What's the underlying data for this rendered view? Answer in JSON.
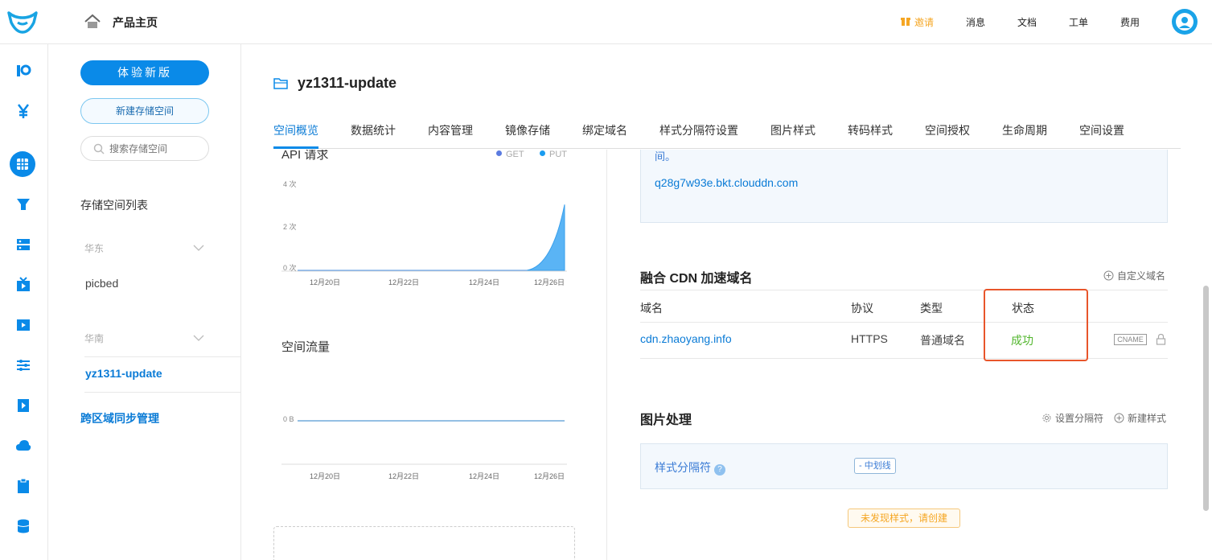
{
  "header": {
    "home_label": "产品主页",
    "nav": {
      "invite": "邀请",
      "messages": "消息",
      "docs": "文档",
      "tickets": "工单",
      "billing": "费用"
    }
  },
  "rail": {
    "icons": [
      "kodo-icon",
      "yuan-icon",
      "storage-grid-icon",
      "cdn-icon",
      "server-icon",
      "live-icon",
      "video-icon",
      "sliders-icon",
      "play-icon",
      "cloud-icon",
      "clipboard-icon",
      "database-icon"
    ]
  },
  "sidebar": {
    "try_new_version": "体验新版",
    "new_bucket": "新建存储空间",
    "search_placeholder": "搜索存储空间",
    "list_title": "存储空间列表",
    "regions": [
      {
        "name": "华东",
        "buckets": [
          "picbed"
        ]
      },
      {
        "name": "华南",
        "buckets": [
          "yz1311-update"
        ]
      }
    ],
    "active_bucket": "yz1311-update",
    "sync_link": "跨区域同步管理"
  },
  "main": {
    "bucket_name": "yz1311-update",
    "tabs": [
      "空间概览",
      "数据统计",
      "内容管理",
      "镜像存储",
      "绑定域名",
      "样式分隔符设置",
      "图片样式",
      "转码样式",
      "空间授权",
      "生命周期",
      "空间设置"
    ],
    "active_tab": "空间概览"
  },
  "charts": {
    "api": {
      "title": "API 请求",
      "legend": [
        "GET",
        "PUT"
      ],
      "yticks": [
        "4 次",
        "2 次",
        "0 次"
      ],
      "xticks": [
        "12月20日",
        "12月22日",
        "12月24日",
        "12月26日"
      ]
    },
    "traffic": {
      "title": "空间流量",
      "yticks": [
        "0 B"
      ],
      "xticks": [
        "12月20日",
        "12月22日",
        "12月24日",
        "12月26日"
      ]
    }
  },
  "chart_data": [
    {
      "type": "area",
      "title": "API 请求",
      "categories": [
        "12月20日",
        "12月22日",
        "12月24日",
        "12月26日"
      ],
      "series": [
        {
          "name": "GET",
          "values": [
            0,
            0,
            0,
            0
          ]
        },
        {
          "name": "PUT",
          "values": [
            0,
            0,
            0,
            3
          ]
        }
      ],
      "yticks": [
        "0 次",
        "2 次",
        "4 次"
      ],
      "ylim": [
        0,
        4
      ]
    },
    {
      "type": "line",
      "title": "空间流量",
      "categories": [
        "12月20日",
        "12月22日",
        "12月24日",
        "12月26日"
      ],
      "series": [
        {
          "values": [
            0,
            0,
            0,
            0
          ]
        }
      ],
      "yticks": [
        "0 B"
      ]
    }
  ],
  "test_domain": {
    "note_tail": "间。",
    "domain": "q28g7w93e.bkt.clouddn.com"
  },
  "cdn": {
    "title": "融合 CDN 加速域名",
    "custom_domain": "自定义域名",
    "columns": [
      "域名",
      "协议",
      "类型",
      "状态"
    ],
    "rows": [
      {
        "domain": "cdn.zhaoyang.info",
        "protocol": "HTTPS",
        "type": "普通域名",
        "status": "成功",
        "cname": "CNAME"
      }
    ]
  },
  "image_processing": {
    "title": "图片处理",
    "set_separator": "设置分隔符",
    "new_style": "新建样式",
    "separator_label": "样式分隔符",
    "separator_tag": "- 中划线",
    "empty_hint": "未发现样式，请创建"
  },
  "colors": {
    "primary": "#0a8ae8",
    "link": "#0a7bd6",
    "success": "#52b62d",
    "warning": "#f5a623",
    "highlight": "#e8552b"
  }
}
